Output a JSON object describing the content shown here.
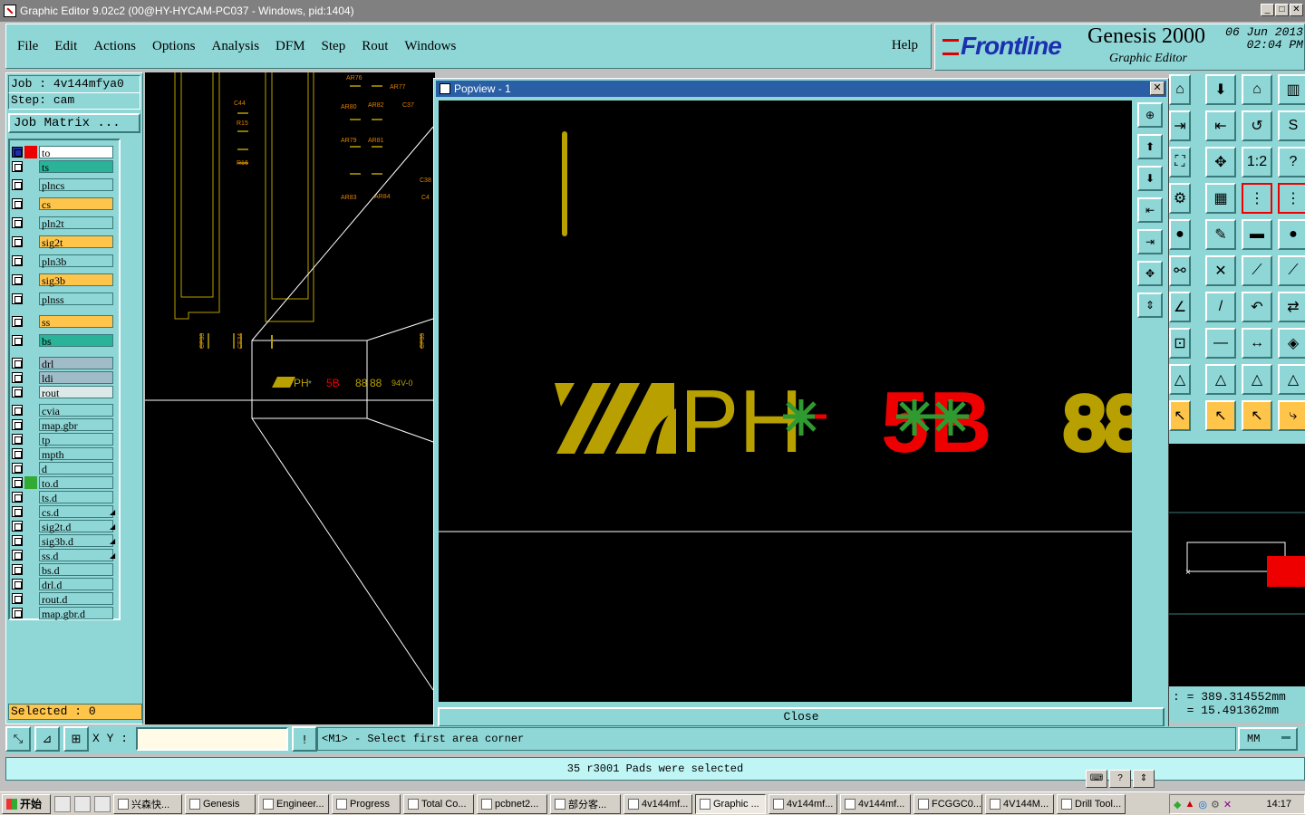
{
  "window": {
    "title": "Graphic Editor 9.02c2 (00@HY-HYCAM-PC037 - Windows, pid:1404)"
  },
  "menu": [
    "File",
    "Edit",
    "Actions",
    "Options",
    "Analysis",
    "DFM",
    "Step",
    "Rout",
    "Windows"
  ],
  "help_label": "Help",
  "brand": {
    "logo": "Frontline",
    "product": "Genesis 2000",
    "subtitle": "Graphic Editor",
    "date": "06 Jun 2013",
    "time": "02:04 PM"
  },
  "job": {
    "label": "Job :",
    "name": "4v144mfya0",
    "step_label": "Step:",
    "step": "cam",
    "matrix_button": "Job Matrix ..."
  },
  "layers": [
    {
      "name": "to",
      "color": "#ffffff",
      "mark": "#e00",
      "active": true
    },
    {
      "name": "ts",
      "color": "#2bb39a"
    },
    {
      "name": "plncs",
      "color": "#8fd6d6"
    },
    {
      "name": "cs",
      "color": "#ffc44a"
    },
    {
      "name": "pln2t",
      "color": "#8fd6d6"
    },
    {
      "name": "sig2t",
      "color": "#ffc44a"
    },
    {
      "name": "pln3b",
      "color": "#8fd6d6"
    },
    {
      "name": "sig3b",
      "color": "#ffc44a"
    },
    {
      "name": "plnss",
      "color": "#8fd6d6"
    },
    {
      "name": "ss",
      "color": "#ffc44a"
    },
    {
      "name": "bs",
      "color": "#2bb39a"
    },
    {
      "name": "drl",
      "color": "#9fbcc8"
    },
    {
      "name": "ldi",
      "color": "#9fbcc8"
    },
    {
      "name": "rout",
      "color": "#dde8e8"
    },
    {
      "name": "cvia",
      "color": "#8fd6d6"
    },
    {
      "name": "map.gbr",
      "color": "#8fd6d6"
    },
    {
      "name": "tp",
      "color": "#8fd6d6"
    },
    {
      "name": "mpth",
      "color": "#8fd6d6"
    },
    {
      "name": "d",
      "color": "#8fd6d6"
    },
    {
      "name": "to.d",
      "color": "#8fd6d6",
      "mark": "#3a3"
    },
    {
      "name": "ts.d",
      "color": "#8fd6d6"
    },
    {
      "name": "cs.d",
      "color": "#8fd6d6",
      "arrow": true
    },
    {
      "name": "sig2t.d",
      "color": "#8fd6d6",
      "arrow": true
    },
    {
      "name": "sig3b.d",
      "color": "#8fd6d6",
      "arrow": true
    },
    {
      "name": "ss.d",
      "color": "#8fd6d6",
      "arrow": true
    },
    {
      "name": "bs.d",
      "color": "#8fd6d6"
    },
    {
      "name": "drl.d",
      "color": "#8fd6d6"
    },
    {
      "name": "rout.d",
      "color": "#8fd6d6"
    },
    {
      "name": "map.gbr.d",
      "color": "#8fd6d6"
    }
  ],
  "selected": "Selected : 0",
  "canvas_labels": [
    "AR76",
    "AR77",
    "AR80",
    "AR82",
    "C37",
    "AR79",
    "AR81",
    "AR83",
    "AR84",
    "C38",
    "C4",
    "C44",
    "R15",
    "R16",
    "CF33",
    "CF34",
    "CF35",
    "94V-0"
  ],
  "popview": {
    "title": "Popview - 1",
    "close_label": "Close",
    "marking_text": "PH",
    "marking_num": "5B",
    "marking_right": "88"
  },
  "coords": {
    "x": "389.314552mm",
    "y": "15.491362mm"
  },
  "command": {
    "xy_label": "X Y :",
    "xy_value": "",
    "prompt": "<M1> - Select first area corner",
    "units": "MM"
  },
  "status": "35 r3001 Pads were selected",
  "taskbar": {
    "start": "开始",
    "tasks": [
      "兴森快...",
      "Genesis",
      "Engineer...",
      "Progress",
      "Total Co...",
      "pcbnet2...",
      "部分客...",
      "4v144mf...",
      "Graphic ...",
      "4v144mf...",
      "4v144mf...",
      "FCGGC0...",
      "4V144M...",
      "Drill Tool..."
    ],
    "clock": "14:17"
  }
}
